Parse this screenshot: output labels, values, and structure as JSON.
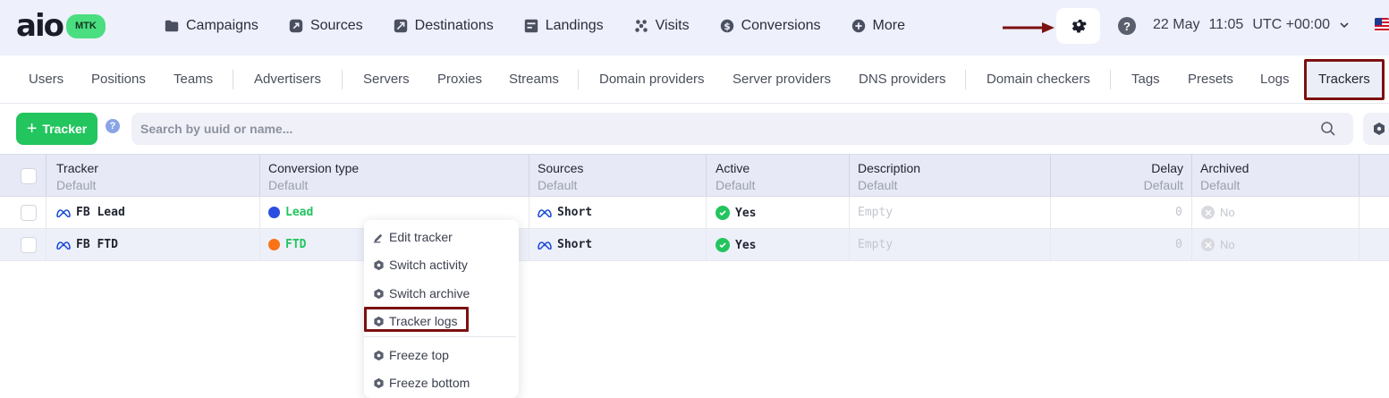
{
  "brand": {
    "logo_text": "aio",
    "badge": "MTK"
  },
  "nav": [
    {
      "label": "Campaigns",
      "icon": "folder-icon"
    },
    {
      "label": "Sources",
      "icon": "share-icon"
    },
    {
      "label": "Destinations",
      "icon": "destination-icon"
    },
    {
      "label": "Landings",
      "icon": "layout-icon"
    },
    {
      "label": "Visits",
      "icon": "users-icon"
    },
    {
      "label": "Conversions",
      "icon": "dollar-icon"
    },
    {
      "label": "More",
      "icon": "plus-circle-icon"
    }
  ],
  "header": {
    "date": "22 May",
    "time": "11:05",
    "timezone": "UTC +00:00",
    "help": "?"
  },
  "subnav": [
    "Users",
    "Positions",
    "Teams",
    "Advertisers",
    "Servers",
    "Proxies",
    "Streams",
    "Domain providers",
    "Server providers",
    "DNS providers",
    "Domain checkers",
    "Tags",
    "Presets",
    "Logs",
    "Trackers"
  ],
  "subnav_active": "Trackers",
  "toolbar": {
    "add_label": "Tracker",
    "help": "?",
    "search_placeholder": "Search by uuid or name..."
  },
  "table": {
    "columns": [
      {
        "title": "Tracker",
        "sub": "Default"
      },
      {
        "title": "Conversion type",
        "sub": "Default"
      },
      {
        "title": "Sources",
        "sub": "Default"
      },
      {
        "title": "Active",
        "sub": "Default"
      },
      {
        "title": "Description",
        "sub": "Default"
      },
      {
        "title": "Delay",
        "sub": "Default"
      },
      {
        "title": "Archived",
        "sub": "Default"
      }
    ],
    "rows": [
      {
        "tracker": "FB Lead",
        "conversion": "Lead",
        "conversion_color": "#2b4de0",
        "source": "Short",
        "active": "Yes",
        "description": "Empty",
        "delay": "0",
        "archived": "No"
      },
      {
        "tracker": "FB FTD",
        "conversion": "FTD",
        "conversion_color": "#f97316",
        "source": "Short",
        "active": "Yes",
        "description": "Empty",
        "delay": "0",
        "archived": "No"
      }
    ]
  },
  "context_menu": {
    "items": [
      "Edit tracker",
      "Switch activity",
      "Switch archive",
      "Tracker logs",
      "Freeze top",
      "Freeze bottom"
    ]
  },
  "colors": {
    "accent_green": "#22c55e",
    "highlight_red": "#7b1111",
    "header_bg": "#eef0fb"
  }
}
